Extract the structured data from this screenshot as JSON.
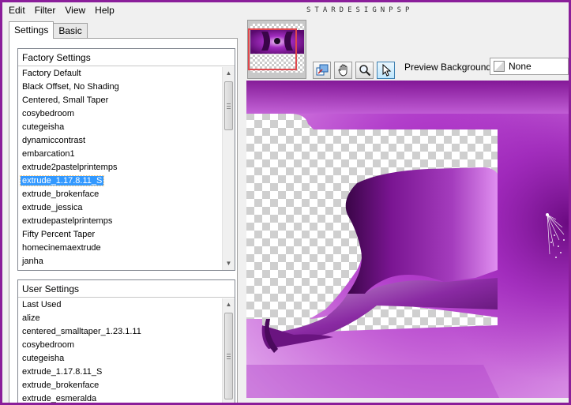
{
  "menu": [
    "Edit",
    "Filter",
    "View",
    "Help"
  ],
  "watermark": "STARDESIGNPSP",
  "tabs": [
    "Settings",
    "Basic"
  ],
  "factory_settings": {
    "header": "Factory Settings",
    "items": [
      "Factory Default",
      "Black Offset, No Shading",
      "Centered, Small Taper",
      "cosybedroom",
      "cutegeisha",
      "dynamiccontrast",
      "embarcation1",
      "extrude2pastelprintemps",
      "extrude_1.17.8.11_S",
      "extrude_brokenface",
      "extrude_jessica",
      "extrudepastelprintemps",
      "Fifty Percent Taper",
      "homecinemaextrude",
      "janha"
    ],
    "selected": "extrude_1.17.8.11_S"
  },
  "user_settings": {
    "header": "User Settings",
    "items": [
      "Last Used",
      "alize",
      "centered_smalltaper_1.23.1.11",
      "cosybedroom",
      "cutegeisha",
      "extrude_1.17.8.11_S",
      "extrude_brokenface",
      "extrude_esmeralda"
    ]
  },
  "toolbar": {
    "tools": [
      {
        "name": "reset-view-tool",
        "icon": "reset-icon"
      },
      {
        "name": "pan-tool",
        "icon": "hand-icon"
      },
      {
        "name": "zoom-tool",
        "icon": "magnifier-icon"
      },
      {
        "name": "pointer-tool",
        "icon": "arrow-pointer-icon",
        "active": true
      }
    ],
    "preview_bg_label": "Preview Background:",
    "preview_bg_value": "None"
  },
  "colors": {
    "frame": "#8a1e9a",
    "selection": "#3399ff",
    "purple_dark": "#5a0a6e",
    "purple_mid": "#a22cc0",
    "purple_light": "#d88ae8"
  }
}
